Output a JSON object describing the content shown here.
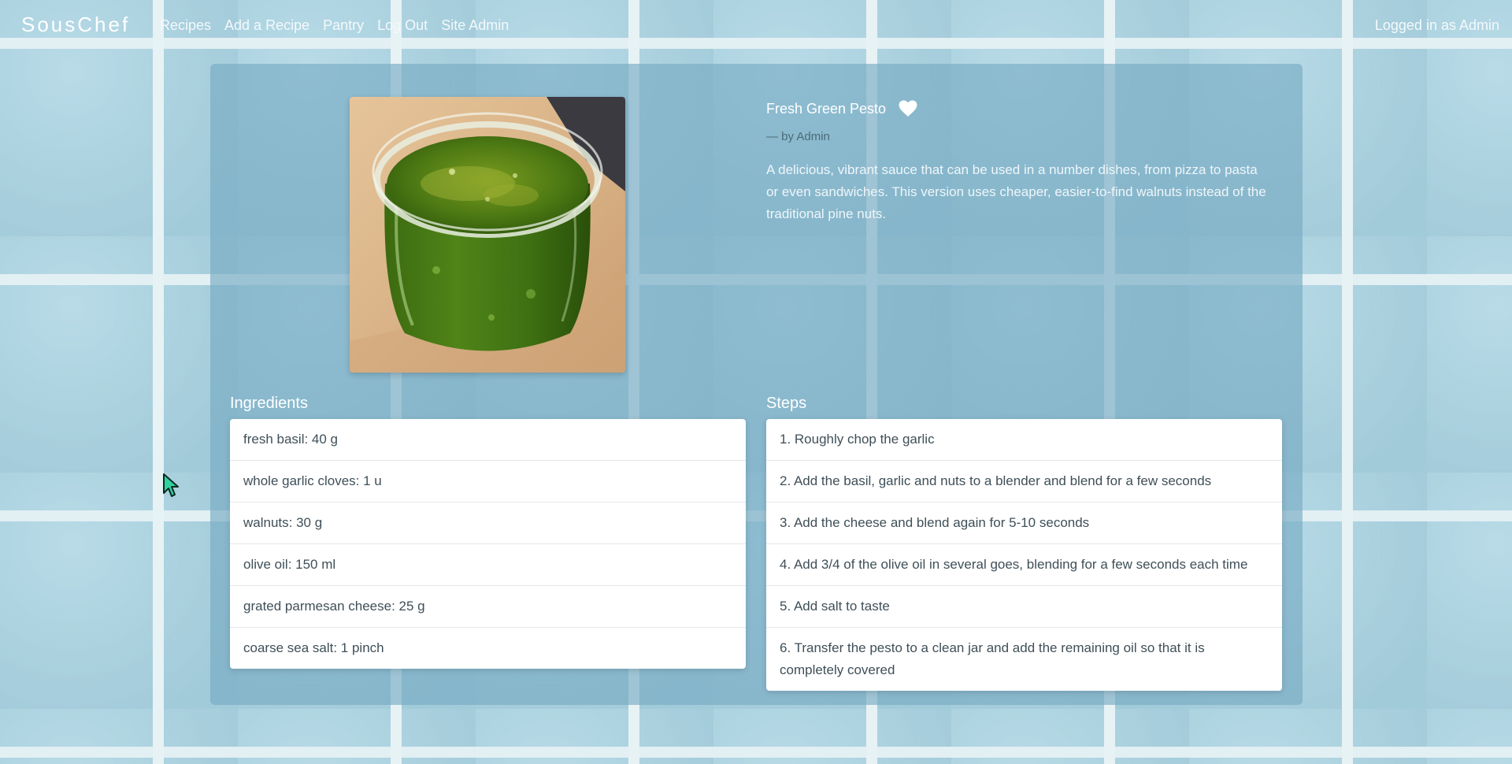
{
  "nav": {
    "brand": "SousChef",
    "links": [
      "Recipes",
      "Add a Recipe",
      "Pantry",
      "Log Out",
      "Site Admin"
    ],
    "user_status": "Logged in as Admin"
  },
  "recipe": {
    "title": "Fresh Green Pesto",
    "author": "— by Admin",
    "description": "A delicious, vibrant sauce that can be used in a number dishes, from pizza to pasta or even sandwiches. This version uses cheaper, easier-to-find walnuts instead of the traditional pine nuts.",
    "favorite_icon": "heart-icon"
  },
  "ingredients": {
    "heading": "Ingredients",
    "items": [
      "fresh basil: 40 g",
      "whole garlic cloves: 1 u",
      "walnuts: 30 g",
      "olive oil: 150 ml",
      "grated parmesan cheese: 25 g",
      "coarse sea salt: 1 pinch"
    ]
  },
  "steps": {
    "heading": "Steps",
    "items": [
      "1. Roughly chop the garlic",
      "2. Add the basil, garlic and nuts to a blender and blend for a few seconds",
      "3. Add the cheese and blend again for 5-10 seconds",
      "4. Add 3/4 of the olive oil in several goes, blending for a few seconds each time",
      "5. Add salt to taste",
      "6. Transfer the pesto to a clean jar and add the remaining oil so that it is completely covered"
    ]
  },
  "colors": {
    "panel": "#78acc4",
    "tile": "#a9d3e2",
    "text_list": "#3f4f58"
  }
}
